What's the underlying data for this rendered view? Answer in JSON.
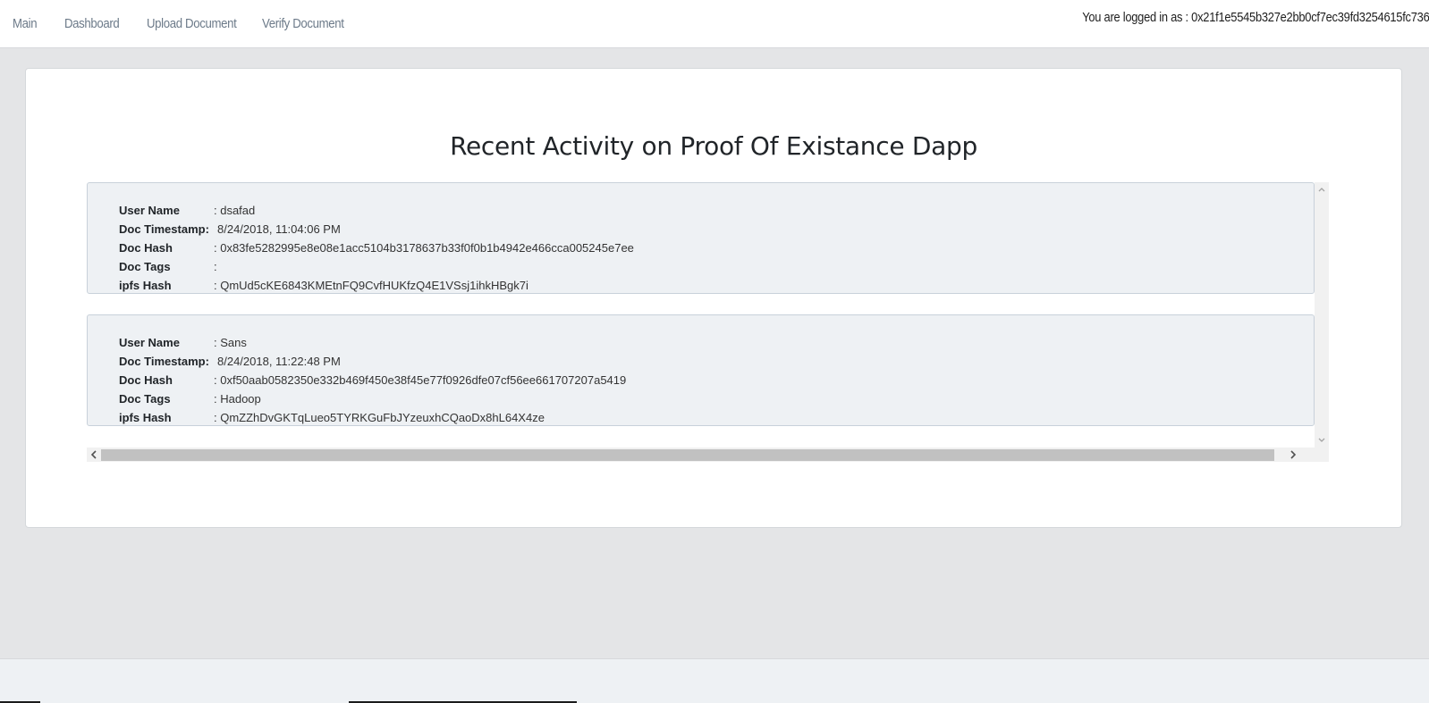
{
  "nav": {
    "items": [
      {
        "label": "Main"
      },
      {
        "label": "Dashboard"
      },
      {
        "label": "Upload Document"
      },
      {
        "label": "Verify Document"
      }
    ],
    "login_status": "You are logged in as : 0x21f1e5545b327e2bb0cf7ec39fd3254615fc736"
  },
  "main": {
    "title": "Recent Activity on Proof Of Existance Dapp",
    "field_labels": {
      "user_name": "User Name",
      "doc_timestamp": "Doc Timestamp:",
      "doc_hash": "Doc Hash",
      "doc_tags": "Doc Tags",
      "ipfs_hash": "ipfs Hash"
    },
    "activities": [
      {
        "user_name": ": dsafad",
        "doc_timestamp": "8/24/2018, 11:04:06 PM",
        "doc_hash": ": 0x83fe5282995e8e08e1acc5104b3178637b33f0f0b1b4942e466cca005245e7ee",
        "doc_tags": ":",
        "ipfs_hash": ": QmUd5cKE6843KMEtnFQ9CvfHUKfzQ4E1VSsj1ihkHBgk7i"
      },
      {
        "user_name": ": Sans",
        "doc_timestamp": "8/24/2018, 11:22:48 PM",
        "doc_hash": ": 0xf50aab0582350e332b469f450e38f45e77f0926dfe07cf56ee661707207a5419",
        "doc_tags": ": Hadoop",
        "ipfs_hash": ": QmZZhDvGKTqLueo5TYRKGuFbJYzeuxhCQaoDx8hL64X4ze"
      }
    ]
  },
  "scrollbar": {
    "up_icon": "chevron-up-icon",
    "down_icon": "chevron-down-icon",
    "left_icon": "chevron-left-icon",
    "right_icon": "chevron-right-icon"
  }
}
